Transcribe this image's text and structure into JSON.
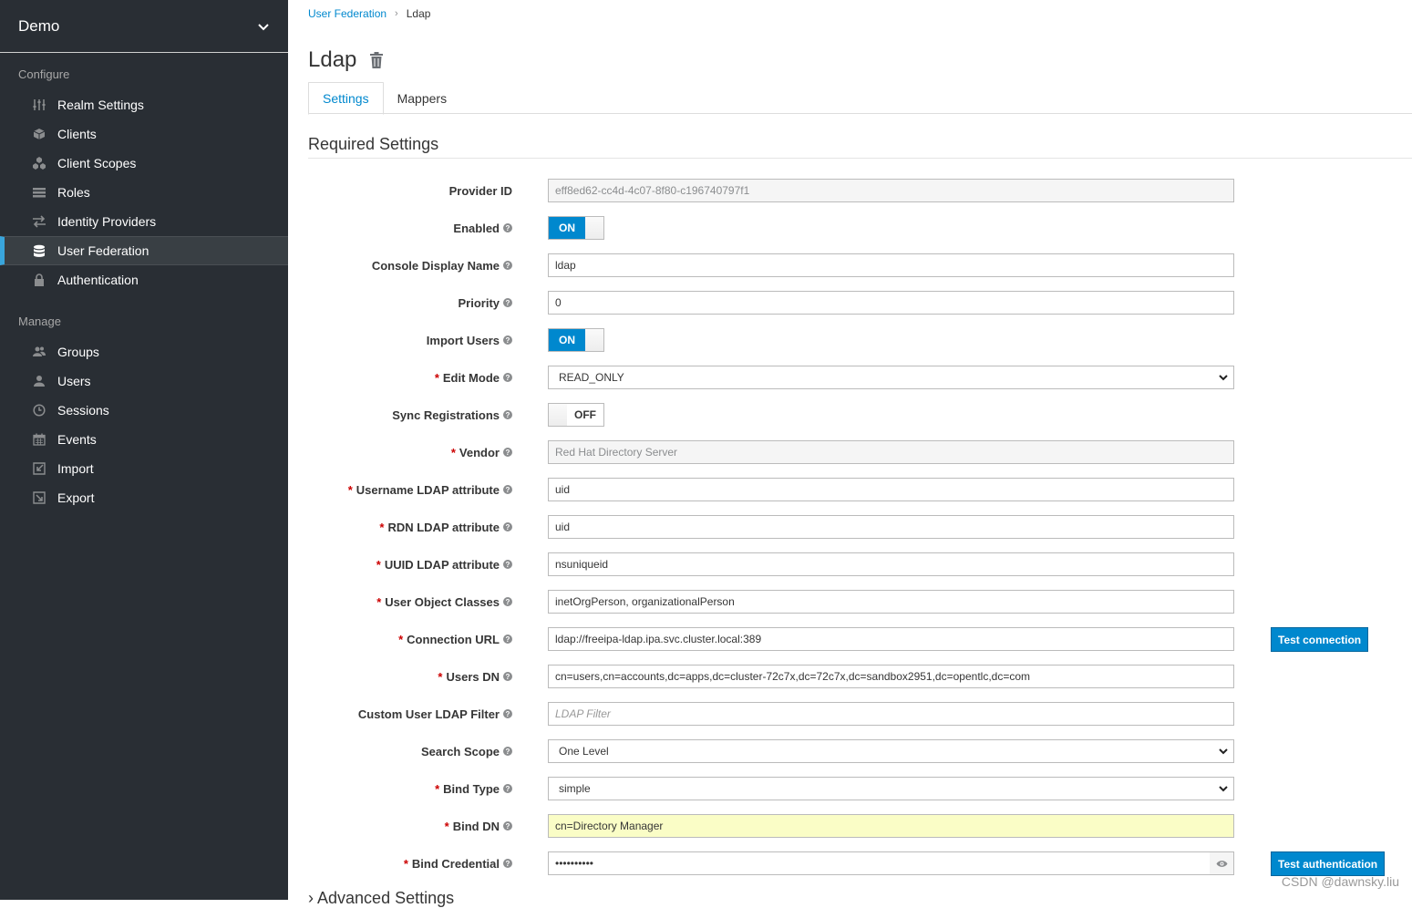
{
  "sidebar": {
    "realm": "Demo",
    "configure_title": "Configure",
    "manage_title": "Manage",
    "configure_items": [
      {
        "label": "Realm Settings",
        "icon": "sliders-icon"
      },
      {
        "label": "Clients",
        "icon": "cube-icon"
      },
      {
        "label": "Client Scopes",
        "icon": "cubes-icon"
      },
      {
        "label": "Roles",
        "icon": "list-icon"
      },
      {
        "label": "Identity Providers",
        "icon": "exchange-icon"
      },
      {
        "label": "User Federation",
        "icon": "database-icon"
      },
      {
        "label": "Authentication",
        "icon": "lock-icon"
      }
    ],
    "manage_items": [
      {
        "label": "Groups",
        "icon": "users-icon"
      },
      {
        "label": "Users",
        "icon": "user-icon"
      },
      {
        "label": "Sessions",
        "icon": "clock-icon"
      },
      {
        "label": "Events",
        "icon": "calendar-icon"
      },
      {
        "label": "Import",
        "icon": "import-icon"
      },
      {
        "label": "Export",
        "icon": "export-icon"
      }
    ]
  },
  "breadcrumb": {
    "parent": "User Federation",
    "current": "Ldap"
  },
  "page": {
    "title": "Ldap"
  },
  "tabs": {
    "settings": "Settings",
    "mappers": "Mappers"
  },
  "section": {
    "title": "Required Settings",
    "advanced": "Advanced Settings"
  },
  "form": {
    "provider_id": {
      "label": "Provider ID",
      "value": "eff8ed62-cc4d-4c07-8f80-c196740797f1"
    },
    "enabled": {
      "label": "Enabled",
      "value": "ON"
    },
    "console_display_name": {
      "label": "Console Display Name",
      "value": "ldap"
    },
    "priority": {
      "label": "Priority",
      "value": "0"
    },
    "import_users": {
      "label": "Import Users",
      "value": "ON"
    },
    "edit_mode": {
      "label": "Edit Mode",
      "value": "READ_ONLY"
    },
    "sync_registrations": {
      "label": "Sync Registrations",
      "value": "OFF"
    },
    "vendor": {
      "label": "Vendor",
      "value": "Red Hat Directory Server"
    },
    "username_ldap_attribute": {
      "label": "Username LDAP attribute",
      "value": "uid"
    },
    "rdn_ldap_attribute": {
      "label": "RDN LDAP attribute",
      "value": "uid"
    },
    "uuid_ldap_attribute": {
      "label": "UUID LDAP attribute",
      "value": "nsuniqueid"
    },
    "user_object_classes": {
      "label": "User Object Classes",
      "value": "inetOrgPerson, organizationalPerson"
    },
    "connection_url": {
      "label": "Connection URL",
      "value": "ldap://freeipa-ldap.ipa.svc.cluster.local:389"
    },
    "users_dn": {
      "label": "Users DN",
      "value": "cn=users,cn=accounts,dc=apps,dc=cluster-72c7x,dc=72c7x,dc=sandbox2951,dc=opentlc,dc=com"
    },
    "custom_user_ldap_filter": {
      "label": "Custom User LDAP Filter",
      "placeholder": "LDAP Filter"
    },
    "search_scope": {
      "label": "Search Scope",
      "value": "One Level"
    },
    "bind_type": {
      "label": "Bind Type",
      "value": "simple"
    },
    "bind_dn": {
      "label": "Bind DN",
      "value": "cn=Directory Manager"
    },
    "bind_credential": {
      "label": "Bind Credential",
      "value": "••••••••••"
    }
  },
  "buttons": {
    "test_connection": "Test connection",
    "test_authentication": "Test authentication"
  },
  "watermark": "CSDN @dawnsky.liu",
  "colors": {
    "sidebar_bg": "#292e34",
    "accent": "#0088ce",
    "active_border": "#39a5dc",
    "required": "#cc0000"
  }
}
